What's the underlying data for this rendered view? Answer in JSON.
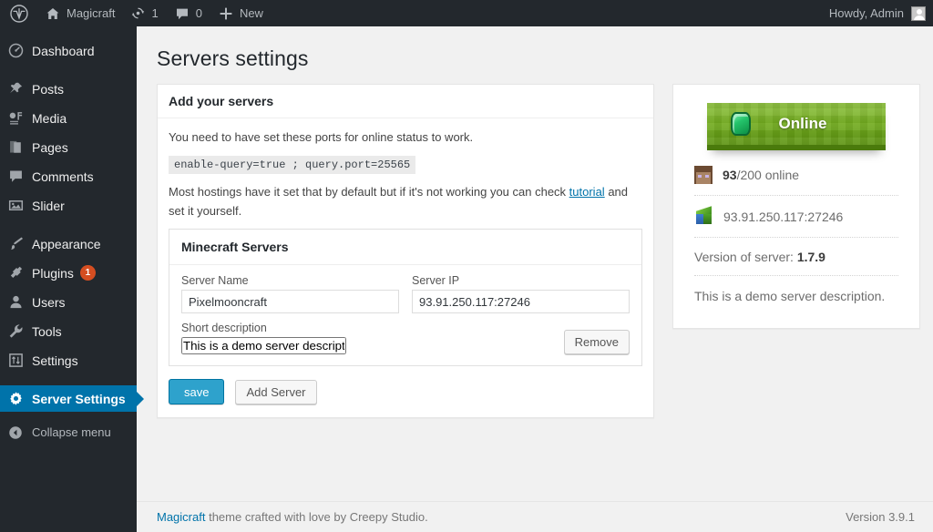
{
  "adminbar": {
    "logo_icon": "wordpress-logo-icon",
    "site_name": "Magicraft",
    "home_icon": "home-icon",
    "updates_icon": "updates-icon",
    "updates_count": "1",
    "comments_icon": "comment-bubble-icon",
    "comments_count": "0",
    "new_icon": "plus-icon",
    "new_label": "New",
    "howdy": "Howdy, Admin",
    "avatar_icon": "user-avatar-icon"
  },
  "sidebar": {
    "items": [
      {
        "label": "Dashboard",
        "icon": "dashboard-icon",
        "active": false
      },
      {
        "label": "Posts",
        "icon": "pin-icon",
        "active": false
      },
      {
        "label": "Media",
        "icon": "media-icon",
        "active": false
      },
      {
        "label": "Pages",
        "icon": "pages-icon",
        "active": false
      },
      {
        "label": "Comments",
        "icon": "comment-bubble-icon",
        "active": false
      },
      {
        "label": "Slider",
        "icon": "image-icon",
        "active": false
      },
      {
        "label": "Appearance",
        "icon": "paintbrush-icon",
        "active": false
      },
      {
        "label": "Plugins",
        "icon": "plug-icon",
        "active": false,
        "badge": "1"
      },
      {
        "label": "Users",
        "icon": "user-icon",
        "active": false
      },
      {
        "label": "Tools",
        "icon": "wrench-icon",
        "active": false
      },
      {
        "label": "Settings",
        "icon": "settings-sliders-icon",
        "active": false
      },
      {
        "label": "Server Settings",
        "icon": "gear-icon",
        "active": true
      }
    ],
    "collapse_label": "Collapse menu",
    "collapse_icon": "chevron-left-circle-icon",
    "active_color": "#0073aa",
    "badge_color": "#d54e21"
  },
  "page": {
    "title": "Servers settings"
  },
  "main_box": {
    "header": "Add your servers",
    "intro": "You need to have set these ports for online status to work.",
    "code": "enable-query=true ; query.port=25565",
    "note_before": "Most hostings have it set that by default but if it's not working you can check ",
    "note_link": "tutorial",
    "note_after": " and set it yourself.",
    "panel_header": "Minecraft Servers",
    "fields": {
      "server_name_label": "Server Name",
      "server_name_value": "Pixelmooncraft",
      "server_name_placeholder": "Server Name",
      "server_ip_label": "Server IP",
      "server_ip_value": "93.91.250.117:27246",
      "server_ip_placeholder": "Server IP",
      "short_description_label": "Short description",
      "short_description_value": "This is a demo server description.",
      "short_description_placeholder": "Short description"
    },
    "remove_label": "Remove",
    "save_label": "save",
    "add_server_label": "Add Server"
  },
  "side_widget": {
    "status_label": "Online",
    "status_icon": "emerald-gem-icon",
    "players_icon": "player-head-icon",
    "players_online": "93",
    "players_rest": "/200 online",
    "address_icon": "grass-block-icon",
    "address": "93.91.250.117:27246",
    "version_label": "Version of server: ",
    "version_value": "1.7.9",
    "description": "This is a demo server description.",
    "badge_green": "#74ae1f"
  },
  "footer": {
    "link": "Magicraft",
    "text": " theme crafted with love by Creepy Studio.",
    "version": "Version 3.9.1"
  }
}
